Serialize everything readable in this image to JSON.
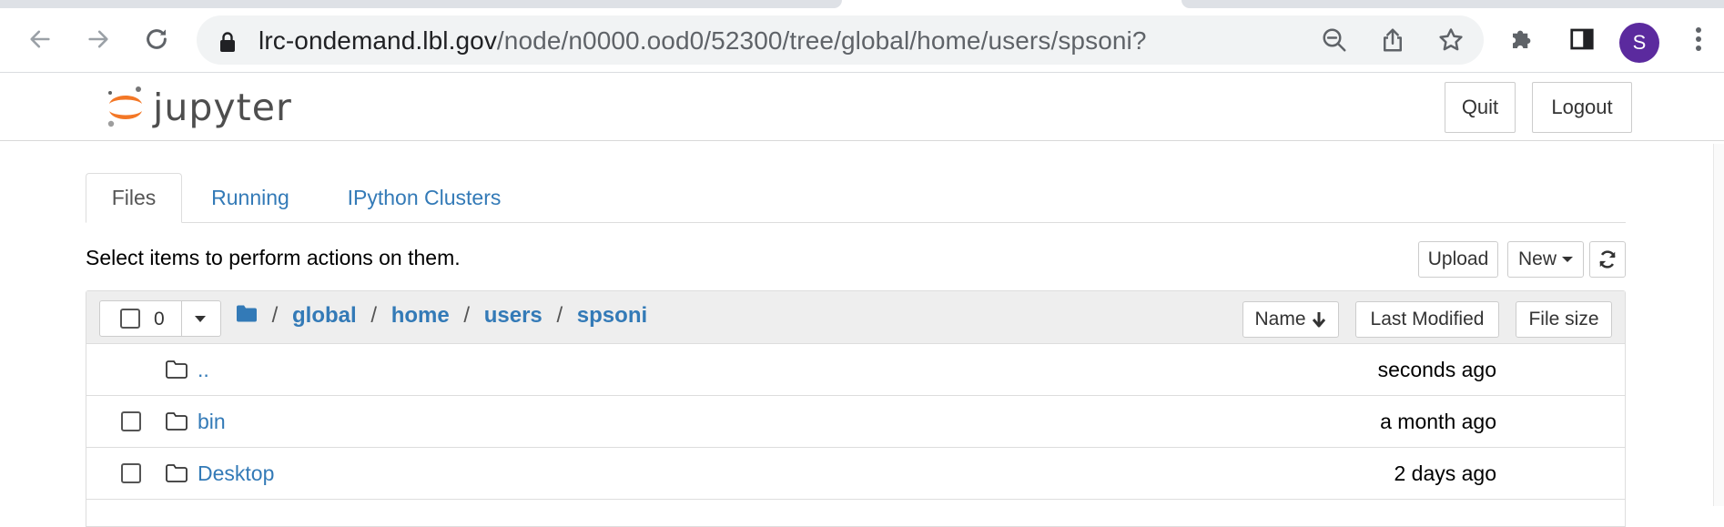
{
  "browser": {
    "url_host": "lrc-ondemand.lbl.gov",
    "url_path": "/node/n0000.ood0/52300/tree/global/home/users/spsoni?",
    "profile_initial": "S"
  },
  "header": {
    "logo_text": "jupyter",
    "quit_label": "Quit",
    "logout_label": "Logout"
  },
  "tabs": [
    {
      "label": "Files"
    },
    {
      "label": "Running"
    },
    {
      "label": "IPython Clusters"
    }
  ],
  "actions": {
    "instructions": "Select items to perform actions on them.",
    "upload_label": "Upload",
    "new_label": "New"
  },
  "list": {
    "selected_count": "0",
    "breadcrumb": [
      "/",
      "global",
      "home",
      "users",
      "spsoni"
    ],
    "sort_name_label": "Name",
    "sort_modified_label": "Last Modified",
    "sort_size_label": "File size",
    "rows": [
      {
        "name": "..",
        "modified": "seconds ago"
      },
      {
        "name": "bin",
        "modified": "a month ago"
      },
      {
        "name": "Desktop",
        "modified": "2 days ago"
      }
    ]
  }
}
